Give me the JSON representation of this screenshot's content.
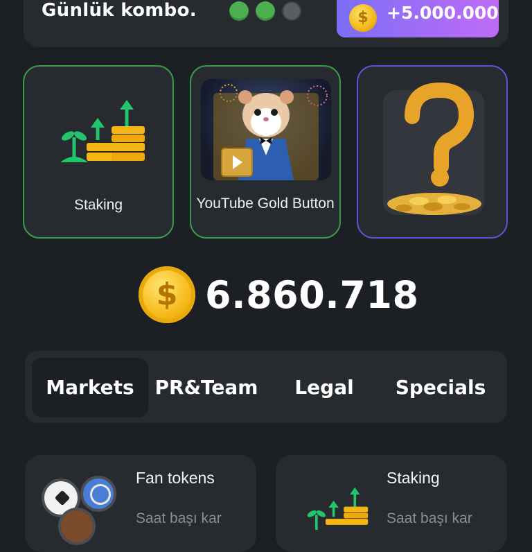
{
  "combo": {
    "title": "Günlük kombo.",
    "dots": [
      "filled",
      "filled",
      "empty"
    ],
    "reward_label": "+5.000.000",
    "reward_icon": "dollar-coin-icon",
    "reward_gradient": [
      "#7a6ff7",
      "#c06bf6"
    ]
  },
  "cards": [
    {
      "label": "Staking",
      "icon": "staking-growth-icon",
      "border": "#3c9a4a"
    },
    {
      "label": "YouTube Gold Button",
      "icon": "hamster-youtube-gold-button-image",
      "border": "#3c9a4a"
    },
    {
      "label": "",
      "icon": "mystery-question-icon",
      "border": "#5b56d8"
    }
  ],
  "balance": {
    "value": "6.860.718",
    "icon": "dollar-coin-icon"
  },
  "tabs": [
    {
      "label": "Markets",
      "active": true
    },
    {
      "label": "PR&Team",
      "active": false
    },
    {
      "label": "Legal",
      "active": false
    },
    {
      "label": "Specials",
      "active": false
    }
  ],
  "upgrades": [
    {
      "title": "Fan tokens",
      "subtitle": "Saat başı kar",
      "icon": "sports-balls-icon"
    },
    {
      "title": "Staking",
      "subtitle": "Saat başı kar",
      "icon": "staking-growth-icon"
    }
  ],
  "colors": {
    "background": "#1c1f24",
    "panel": "#272a2f",
    "dot_active": "#4caf50",
    "coin": "#f5b614",
    "staking_green": "#22c56e"
  }
}
